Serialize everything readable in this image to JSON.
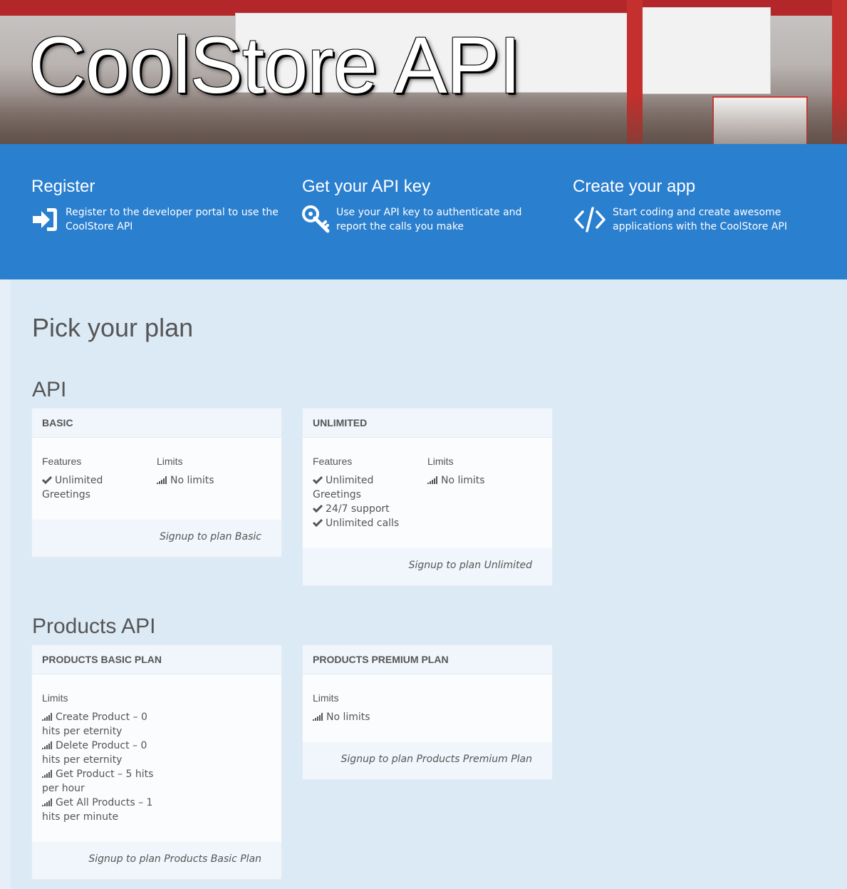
{
  "hero": {
    "title": "CoolStore API"
  },
  "steps": [
    {
      "title": "Register",
      "text": "Register to the developer portal to use the CoolStore API",
      "icon": "sign-in-icon"
    },
    {
      "title": "Get your API key",
      "text": "Use your API key to authenticate and report the calls you make",
      "icon": "key-icon"
    },
    {
      "title": "Create your app",
      "text": "Start coding and create awesome applications with the CoolStore API",
      "icon": "code-icon"
    }
  ],
  "page_title": "Pick your plan",
  "sections": [
    {
      "name": "API",
      "plans": [
        {
          "name": "Basic",
          "features_label": "Features",
          "features": [
            "Unlimited Greetings"
          ],
          "limits_label": "Limits",
          "limits": [
            "No limits"
          ],
          "signup": "Signup to plan Basic"
        },
        {
          "name": "Unlimited",
          "features_label": "Features",
          "features": [
            "Unlimited Greetings",
            "24/7 support",
            "Unlimited calls"
          ],
          "limits_label": "Limits",
          "limits": [
            "No limits"
          ],
          "signup": "Signup to plan Unlimited"
        }
      ]
    },
    {
      "name": "Products API",
      "plans": [
        {
          "name": "Products Basic Plan",
          "limits_label": "Limits",
          "limits": [
            "Create Product – 0 hits per eternity",
            "Delete Product – 0 hits per eternity",
            "Get Product – 5 hits per hour",
            "Get All Products – 1 hits per minute"
          ],
          "signup": "Signup to plan Products Basic Plan"
        },
        {
          "name": "Products Premium Plan",
          "limits_label": "Limits",
          "limits": [
            "No limits"
          ],
          "signup": "Signup to plan Products Premium Plan"
        }
      ]
    }
  ],
  "colors": {
    "band": "#2a7fcf",
    "content_bg": "#dceaf6",
    "card_head": "#f0f6fb"
  }
}
